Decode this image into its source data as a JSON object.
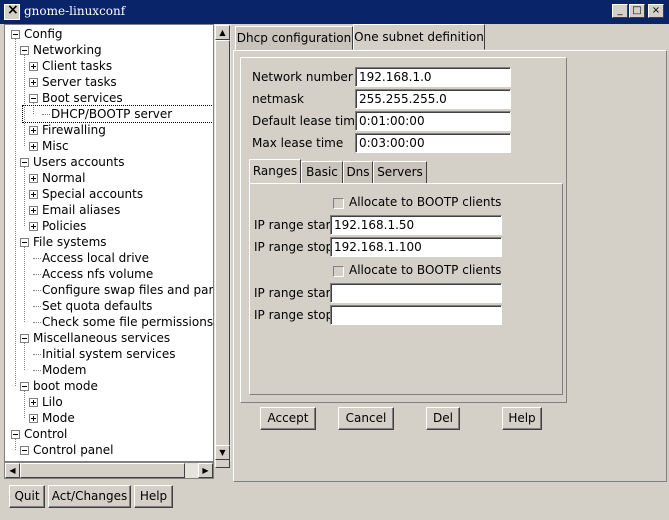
{
  "window": {
    "title": "gnome-linuxconf",
    "buttons": {
      "minimize": "_",
      "maximize": "□",
      "close": "×"
    }
  },
  "tree": {
    "items": [
      {
        "label": "Config",
        "level": 0,
        "expander": "minus"
      },
      {
        "label": "Networking",
        "level": 1,
        "expander": "minus"
      },
      {
        "label": "Client tasks",
        "level": 2,
        "expander": "plus"
      },
      {
        "label": "Server tasks",
        "level": 2,
        "expander": "plus"
      },
      {
        "label": "Boot services",
        "level": 2,
        "expander": "minus"
      },
      {
        "label": "DHCP/BOOTP server",
        "level": 3,
        "expander": "none",
        "selected": true
      },
      {
        "label": "Firewalling",
        "level": 2,
        "expander": "plus"
      },
      {
        "label": "Misc",
        "level": 2,
        "expander": "plus"
      },
      {
        "label": "Users accounts",
        "level": 1,
        "expander": "minus"
      },
      {
        "label": "Normal",
        "level": 2,
        "expander": "plus"
      },
      {
        "label": "Special accounts",
        "level": 2,
        "expander": "plus"
      },
      {
        "label": "Email aliases",
        "level": 2,
        "expander": "plus"
      },
      {
        "label": "Policies",
        "level": 2,
        "expander": "plus"
      },
      {
        "label": "File systems",
        "level": 1,
        "expander": "minus"
      },
      {
        "label": "Access local drive",
        "level": 2,
        "expander": "none"
      },
      {
        "label": "Access nfs volume",
        "level": 2,
        "expander": "none"
      },
      {
        "label": "Configure swap files and part",
        "level": 2,
        "expander": "none"
      },
      {
        "label": "Set quota defaults",
        "level": 2,
        "expander": "none"
      },
      {
        "label": "Check some file permissions",
        "level": 2,
        "expander": "none"
      },
      {
        "label": "Miscellaneous services",
        "level": 1,
        "expander": "minus"
      },
      {
        "label": "Initial system services",
        "level": 2,
        "expander": "none"
      },
      {
        "label": "Modem",
        "level": 2,
        "expander": "none"
      },
      {
        "label": "boot mode",
        "level": 1,
        "expander": "minus"
      },
      {
        "label": "Lilo",
        "level": 2,
        "expander": "plus"
      },
      {
        "label": "Mode",
        "level": 2,
        "expander": "plus"
      },
      {
        "label": "Control",
        "level": 0,
        "expander": "minus"
      },
      {
        "label": "Control panel",
        "level": 1,
        "expander": "minus"
      }
    ]
  },
  "bottom_buttons": {
    "quit": "Quit",
    "act_changes": "Act/Changes",
    "help": "Help"
  },
  "main_tabs": {
    "dhcp_configuration": "Dhcp configuration",
    "one_subnet_definition": "One subnet definition"
  },
  "subnet": {
    "network_number_label": "Network number",
    "network_number": "192.168.1.0",
    "netmask_label": "netmask",
    "netmask": "255.255.255.0",
    "default_lease_label": "Default lease time",
    "default_lease": "0:01:00:00",
    "max_lease_label": "Max lease time",
    "max_lease": "0:03:00:00"
  },
  "sub_tabs": {
    "ranges": "Ranges",
    "basic": "Basic",
    "dns": "Dns",
    "servers": "Servers"
  },
  "ranges": {
    "allocate_label": "Allocate to BOOTP clients",
    "range1": {
      "start_label": "IP range start",
      "start": "192.168.1.50",
      "stop_label": "IP range stop",
      "stop": "192.168.1.100"
    },
    "range2": {
      "start_label": "IP range start",
      "start": "",
      "stop_label": "IP range stop",
      "stop": ""
    }
  },
  "actions": {
    "accept": "Accept",
    "cancel": "Cancel",
    "del": "Del",
    "help": "Help"
  }
}
